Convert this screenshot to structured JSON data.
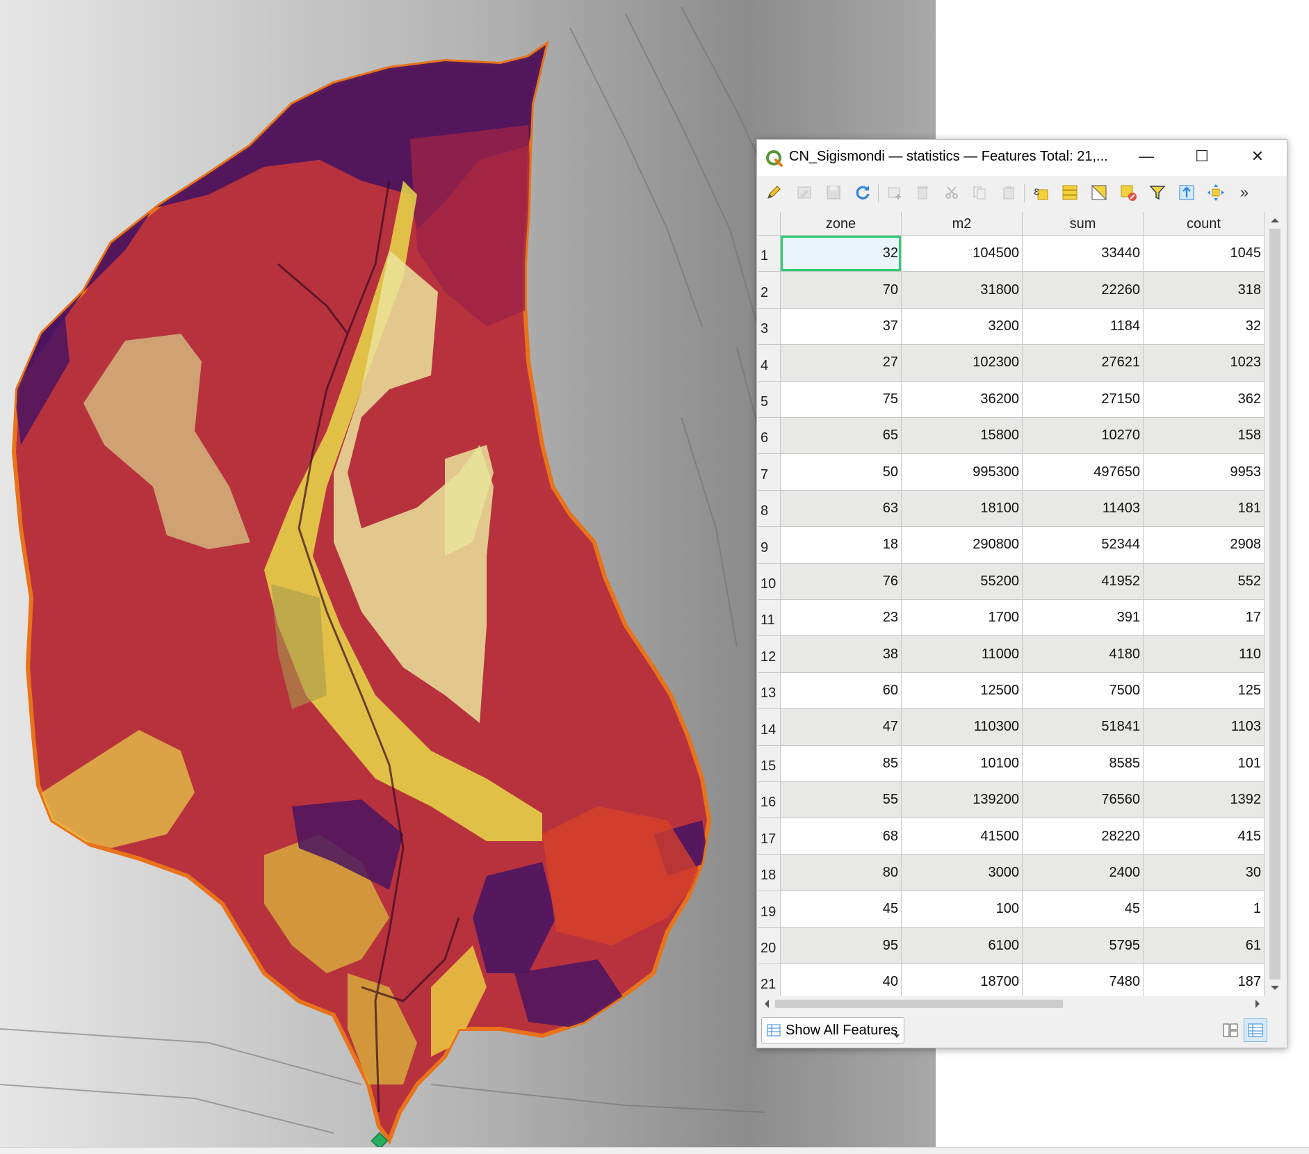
{
  "window": {
    "title": "CN_Sigismondi — statistics — Features Total: 21,...",
    "minimize_glyph": "—",
    "maximize_glyph": "☐",
    "close_glyph": "✕"
  },
  "toolbar": {
    "icons": [
      "pencil-icon",
      "multi-edit-icon",
      "save-edits-icon",
      "reload-icon",
      "add-feature-icon",
      "delete-feature-icon",
      "cut-icon",
      "copy-icon",
      "paste-icon",
      "expression-select-icon",
      "select-all-icon",
      "invert-selection-icon",
      "deselect-all-icon",
      "filter-icon",
      "move-selection-top-icon",
      "pan-to-selected-icon",
      "more-icon"
    ],
    "more_glyph": "»"
  },
  "table": {
    "columns": [
      "zone",
      "m2",
      "sum",
      "count"
    ],
    "rows": [
      {
        "n": "1",
        "zone": "32",
        "m2": "104500",
        "sum": "33440",
        "count": "1045"
      },
      {
        "n": "2",
        "zone": "70",
        "m2": "31800",
        "sum": "22260",
        "count": "318"
      },
      {
        "n": "3",
        "zone": "37",
        "m2": "3200",
        "sum": "1184",
        "count": "32"
      },
      {
        "n": "4",
        "zone": "27",
        "m2": "102300",
        "sum": "27621",
        "count": "1023"
      },
      {
        "n": "5",
        "zone": "75",
        "m2": "36200",
        "sum": "27150",
        "count": "362"
      },
      {
        "n": "6",
        "zone": "65",
        "m2": "15800",
        "sum": "10270",
        "count": "158"
      },
      {
        "n": "7",
        "zone": "50",
        "m2": "995300",
        "sum": "497650",
        "count": "9953"
      },
      {
        "n": "8",
        "zone": "63",
        "m2": "18100",
        "sum": "11403",
        "count": "181"
      },
      {
        "n": "9",
        "zone": "18",
        "m2": "290800",
        "sum": "52344",
        "count": "2908"
      },
      {
        "n": "10",
        "zone": "76",
        "m2": "55200",
        "sum": "41952",
        "count": "552"
      },
      {
        "n": "11",
        "zone": "23",
        "m2": "1700",
        "sum": "391",
        "count": "17"
      },
      {
        "n": "12",
        "zone": "38",
        "m2": "11000",
        "sum": "4180",
        "count": "110"
      },
      {
        "n": "13",
        "zone": "60",
        "m2": "12500",
        "sum": "7500",
        "count": "125"
      },
      {
        "n": "14",
        "zone": "47",
        "m2": "110300",
        "sum": "51841",
        "count": "1103"
      },
      {
        "n": "15",
        "zone": "85",
        "m2": "10100",
        "sum": "8585",
        "count": "101"
      },
      {
        "n": "16",
        "zone": "55",
        "m2": "139200",
        "sum": "76560",
        "count": "1392"
      },
      {
        "n": "17",
        "zone": "68",
        "m2": "41500",
        "sum": "28220",
        "count": "415"
      },
      {
        "n": "18",
        "zone": "80",
        "m2": "3000",
        "sum": "2400",
        "count": "30"
      },
      {
        "n": "19",
        "zone": "45",
        "m2": "100",
        "sum": "45",
        "count": "1"
      },
      {
        "n": "20",
        "zone": "95",
        "m2": "6100",
        "sum": "5795",
        "count": "61"
      },
      {
        "n": "21",
        "zone": "40",
        "m2": "18700",
        "sum": "7480",
        "count": "187"
      }
    ]
  },
  "footer": {
    "show_all_label": "Show All Features"
  },
  "colors": {
    "selection_border": "#2ecc71",
    "alt_row": "#e8e8e6",
    "basin_red": "#b8323e",
    "basin_purple": "#4a1460",
    "basin_yellow": "#e8d94a",
    "basin_orange": "#e8731a",
    "outlet_green": "#27ae60"
  }
}
